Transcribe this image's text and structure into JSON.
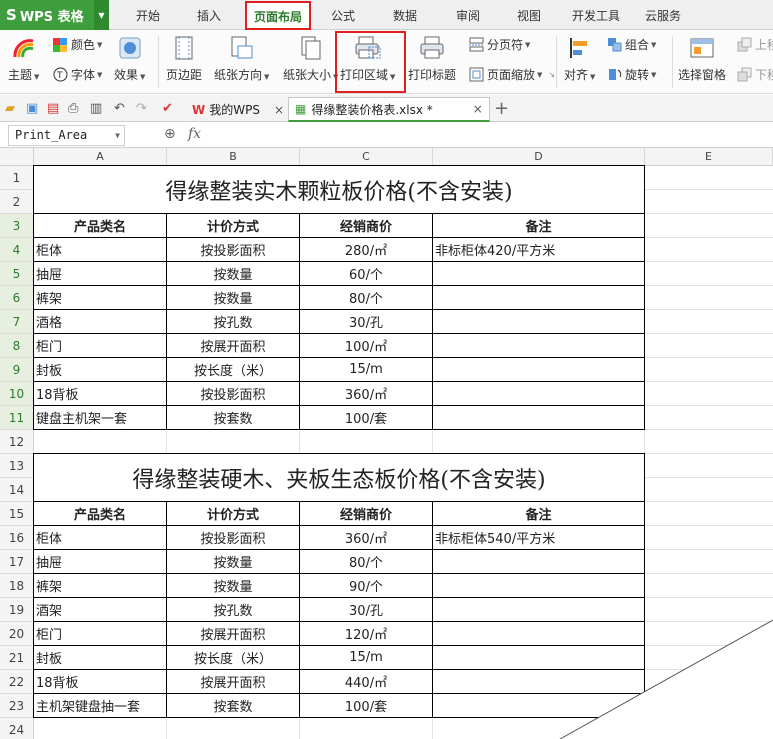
{
  "app": {
    "logo": "WPS 表格"
  },
  "ribbon_tabs": [
    "开始",
    "插入",
    "页面布局",
    "公式",
    "数据",
    "审阅",
    "视图",
    "开发工具",
    "云服务"
  ],
  "ribbon": {
    "theme": "主题",
    "color": "颜色",
    "font": "字体",
    "effect": "效果",
    "margins": "页边距",
    "orientation": "纸张方向",
    "size": "纸张大小",
    "print_area": "打印区域",
    "print_titles": "打印标题",
    "page_break": "分页符",
    "page_zoom": "页面缩放",
    "align": "对齐",
    "group": "组合",
    "rotate": "旋转",
    "selection_pane": "选择窗格",
    "bring_forward": "上移",
    "send_backward": "下移"
  },
  "doc_tabs": {
    "home": "我的WPS",
    "active_file": "得缘整装价格表.xlsx *"
  },
  "formula_bar": {
    "name_box": "Print_Area",
    "fx": "fx"
  },
  "columns": [
    "A",
    "B",
    "C",
    "D",
    "E"
  ],
  "rows": [
    "1",
    "2",
    "3",
    "4",
    "5",
    "6",
    "7",
    "8",
    "9",
    "10",
    "11",
    "12",
    "13",
    "14",
    "15",
    "16",
    "17",
    "18",
    "19",
    "20",
    "21",
    "22",
    "23",
    "24"
  ],
  "sheet": {
    "title1": "得缘整装实木颗粒板价格(不含安装)",
    "title2": "得缘整装硬木、夹板生态板价格(不含安装)",
    "headers": [
      "产品类名",
      "计价方式",
      "经销商价",
      "备注"
    ],
    "table1": [
      [
        "柜体",
        "按投影面积",
        "280/㎡",
        "非标柜体420/平方米"
      ],
      [
        "抽屉",
        "按数量",
        "60/个",
        ""
      ],
      [
        "裤架",
        "按数量",
        "80/个",
        ""
      ],
      [
        "酒格",
        "按孔数",
        "30/孔",
        ""
      ],
      [
        "柜门",
        "按展开面积",
        "100/㎡",
        ""
      ],
      [
        "封板",
        "按长度（米）",
        "15/m",
        ""
      ],
      [
        "18背板",
        "按投影面积",
        "360/㎡",
        ""
      ],
      [
        "键盘主机架一套",
        "按套数",
        "100/套",
        ""
      ]
    ],
    "table2": [
      [
        "柜体",
        "按投影面积",
        "360/㎡",
        "非标柜体540/平方米"
      ],
      [
        "抽屉",
        "按数量",
        "80/个",
        ""
      ],
      [
        "裤架",
        "按数量",
        "90/个",
        ""
      ],
      [
        "酒架",
        "按孔数",
        "30/孔",
        ""
      ],
      [
        "柜门",
        "按展开面积",
        "120/㎡",
        ""
      ],
      [
        "封板",
        "按长度（米）",
        "15/m",
        ""
      ],
      [
        "18背板",
        "按展开面积",
        "440/㎡",
        ""
      ],
      [
        "主机架键盘抽一套",
        "按套数",
        "100/套",
        ""
      ]
    ]
  }
}
